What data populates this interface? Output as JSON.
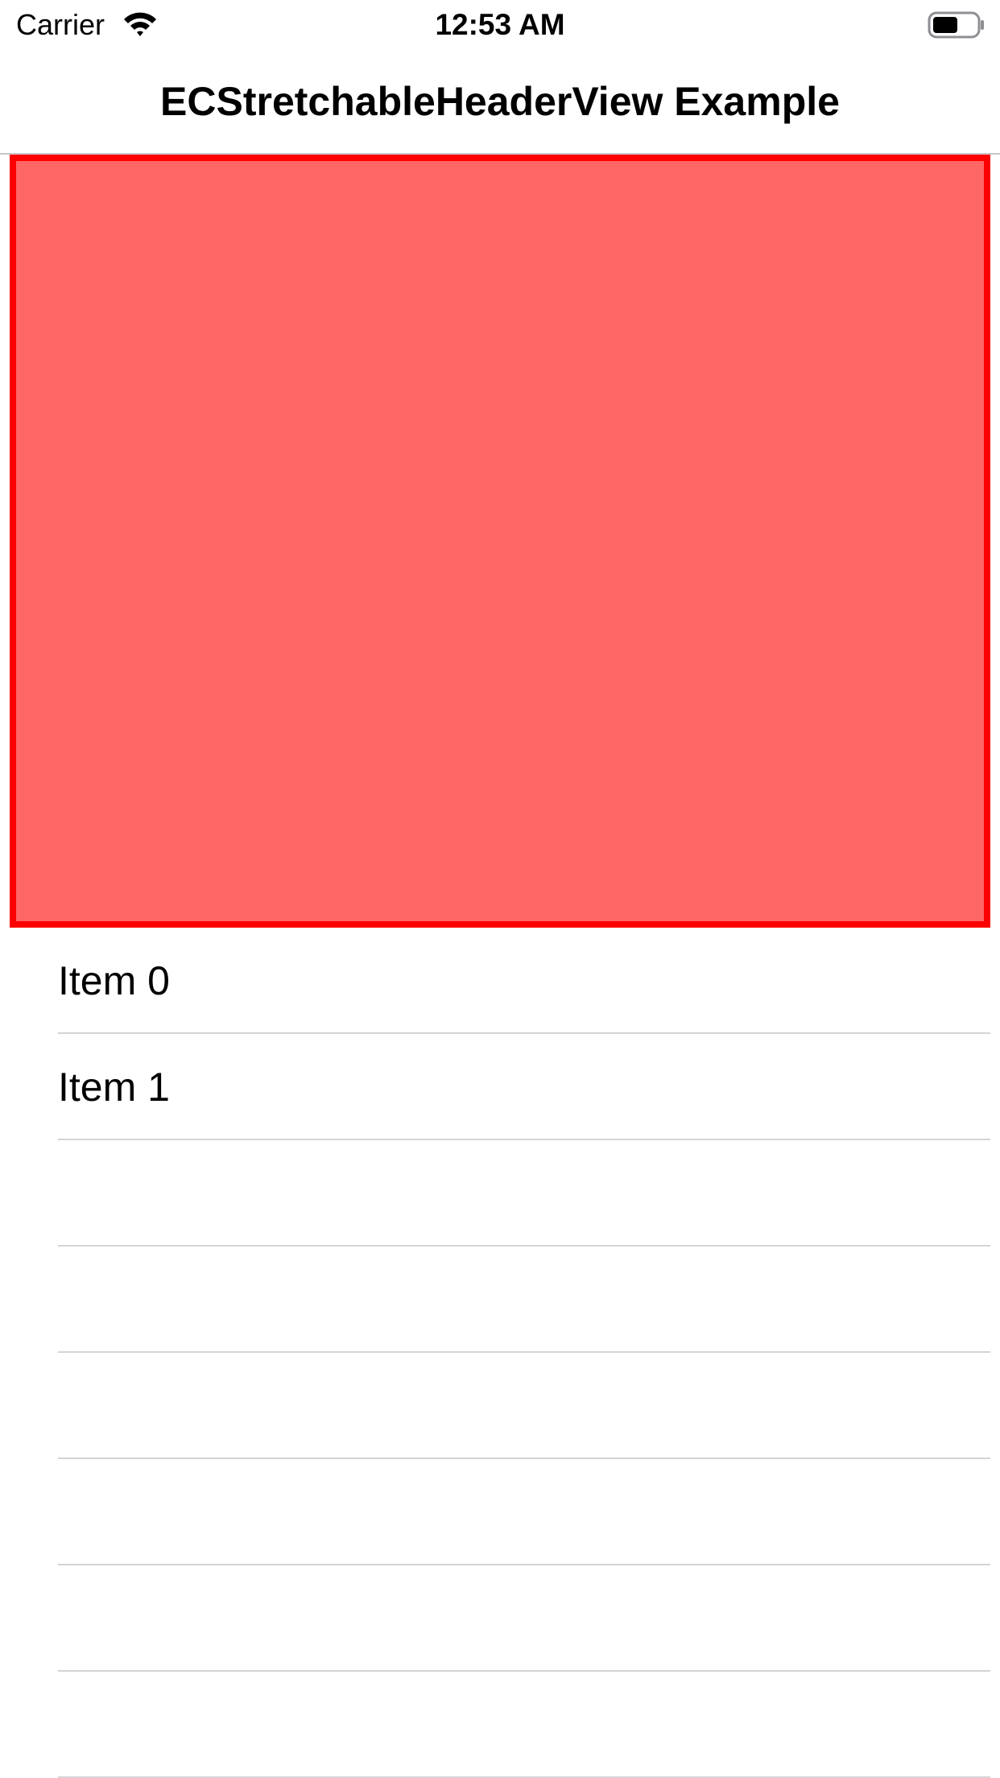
{
  "status_bar": {
    "carrier": "Carrier",
    "time": "12:53 AM",
    "wifi_icon": "wifi-icon",
    "battery_icon": "battery-icon"
  },
  "nav_bar": {
    "title": "ECStretchableHeaderView Example"
  },
  "header_view": {
    "fill_color": "#ff6666",
    "border_color": "#ff0000"
  },
  "table": {
    "rows": [
      {
        "label": "Item 0"
      },
      {
        "label": "Item 1"
      },
      {
        "label": ""
      },
      {
        "label": ""
      },
      {
        "label": ""
      },
      {
        "label": ""
      },
      {
        "label": ""
      },
      {
        "label": ""
      }
    ]
  }
}
